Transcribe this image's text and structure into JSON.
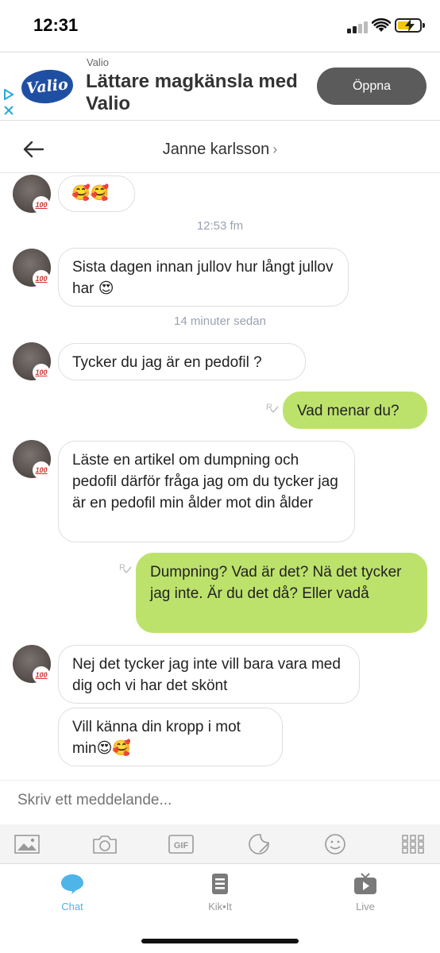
{
  "status_bar": {
    "time": "12:31"
  },
  "ad": {
    "brand": "Valio",
    "logo_text": "Valio",
    "headline": "Lättare magkänsla med Valio",
    "cta": "Öppna"
  },
  "header": {
    "title": "Janne karlsson",
    "chevron": "›"
  },
  "avatar_badge": "100",
  "messages": [
    {
      "text": "🥰🥰"
    },
    {
      "text": "Sista dagen innan jullov  hur långt jullov har 😍"
    },
    {
      "text": "Tycker du jag är en pedofil ?"
    },
    {
      "text": "Vad menar du?"
    },
    {
      "text": "Läste en artikel  om dumpning och pedofil därför fråga jag om du tycker jag är en pedofil min ålder mot din ålder"
    },
    {
      "text": "Dumpning? Vad är det? Nä det tycker jag inte. Är du det då? Eller vadå"
    },
    {
      "text": "Nej det tycker jag inte vill bara vara med dig  och vi har det skönt"
    },
    {
      "text": "Vill känna din kropp i mot min😍🥰"
    }
  ],
  "timestamps": [
    "12:53 fm",
    "14 minuter sedan"
  ],
  "read_receipt": "R",
  "composer": {
    "placeholder": "Skriv ett meddelande..."
  },
  "media_bar": {
    "icons": [
      "image-icon",
      "camera-icon",
      "gif-icon",
      "sticker-icon",
      "emoji-icon",
      "apps-grid-icon"
    ],
    "gif_label": "GIF"
  },
  "nav": {
    "chat": "Chat",
    "kikit": "Kik•It",
    "live": "Live"
  },
  "colors": {
    "outgoing_bubble": "#bde26c",
    "active_nav": "#4fb4e8",
    "ad_button": "#5b5b5b",
    "valio_blue": "#1f4fa3"
  }
}
